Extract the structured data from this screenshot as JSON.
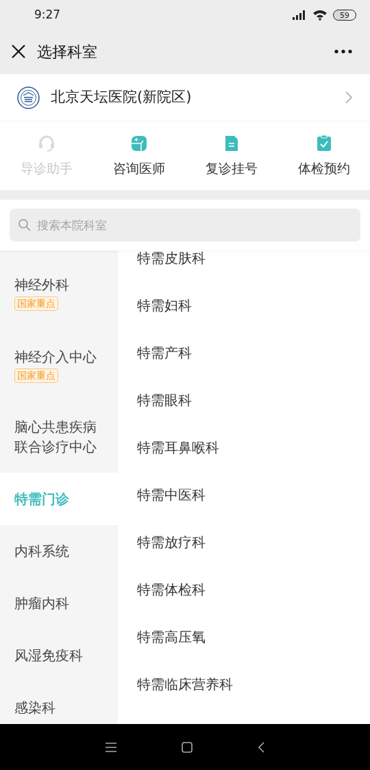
{
  "status_bar": {
    "time": "9:27",
    "battery": "59"
  },
  "header": {
    "title": "选择科室"
  },
  "hospital": {
    "name": "北京天坛医院(新院区)"
  },
  "actions": [
    {
      "kind": "headset",
      "label": "导诊助手",
      "disabled": true
    },
    {
      "kind": "doctor",
      "label": "咨询医师",
      "disabled": false
    },
    {
      "kind": "document",
      "label": "复诊挂号",
      "disabled": false
    },
    {
      "kind": "clipboard",
      "label": "体检预约",
      "disabled": false
    }
  ],
  "search": {
    "placeholder": "搜索本院科室"
  },
  "categories": [
    {
      "lines": [
        "神经外科"
      ],
      "tag": "国家重点",
      "selected": false
    },
    {
      "lines": [
        "神经介入中心"
      ],
      "tag": "国家重点",
      "selected": false
    },
    {
      "lines": [
        "脑心共患疾病",
        "联合诊疗中心"
      ],
      "selected": false
    },
    {
      "lines": [
        "特需门诊"
      ],
      "selected": true
    },
    {
      "lines": [
        "内科系统"
      ],
      "selected": false
    },
    {
      "lines": [
        "肿瘤内科"
      ],
      "selected": false
    },
    {
      "lines": [
        "风湿免疫科"
      ],
      "selected": false
    },
    {
      "lines": [
        "感染科"
      ],
      "selected": false
    }
  ],
  "departments": [
    "特需皮肤科",
    "特需妇科",
    "特需产科",
    "特需眼科",
    "特需耳鼻喉科",
    "特需中医科",
    "特需放疗科",
    "特需体检科",
    "特需高压氧",
    "特需临床营养科"
  ]
}
